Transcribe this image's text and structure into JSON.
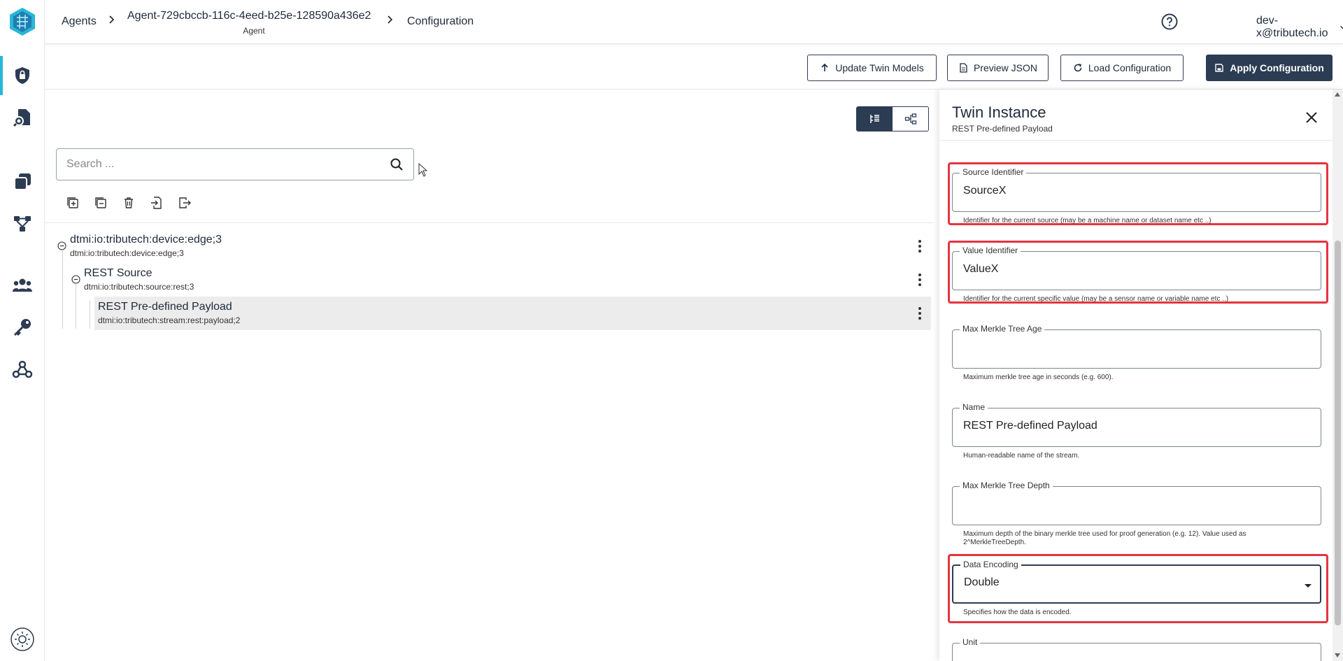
{
  "nav": {
    "items": [
      "lock-shield-icon",
      "document-search-icon",
      "stacked-cards-icon",
      "workflow-icon",
      "users-icon",
      "key-icon",
      "webhook-icon"
    ],
    "active": 0
  },
  "breadcrumb": {
    "agents": "Agents",
    "agent_id": "Agent-729cbccb-116c-4eed-b25e-128590a436e2",
    "agent_sub": "Agent",
    "config": "Configuration"
  },
  "user": {
    "email": "dev-x@tributech.io"
  },
  "toolbar": {
    "update": "Update Twin Models",
    "preview": "Preview JSON",
    "load": "Load Configuration",
    "apply": "Apply Configuration"
  },
  "search": {
    "placeholder": "Search ..."
  },
  "tree": {
    "root": {
      "name": "dtmi:io:tributech:device:edge;3",
      "id": "dtmi:io:tributech:device:edge;3"
    },
    "source": {
      "name": "REST Source",
      "id": "dtmi:io:tributech:source:rest;3"
    },
    "stream": {
      "name": "REST Pre-defined Payload",
      "id": "dtmi:io:tributech:stream:rest:payload;2"
    }
  },
  "panel": {
    "title": "Twin Instance",
    "subtitle": "REST Pre-defined Payload",
    "fields": [
      {
        "label": "Source Identifier",
        "value": "SourceX",
        "hint": "Identifier for the current source (may be a machine name or dataset name etc ..)"
      },
      {
        "label": "Value Identifier",
        "value": "ValueX",
        "hint": "Identifier for the current specific value (may be a sensor name or variable name etc ..)"
      },
      {
        "label": "Max Merkle Tree Age",
        "value": "",
        "hint": "Maximum merkle tree age in seconds (e.g. 600)."
      },
      {
        "label": "Name",
        "value": "REST Pre-defined Payload",
        "hint": "Human-readable name of the stream."
      },
      {
        "label": "Max Merkle Tree Depth",
        "value": "",
        "hint": "Maximum depth of the binary merkle tree used for proof generation (e.g. 12). Value used as 2^MerkleTreeDepth."
      },
      {
        "label": "Data Encoding",
        "value": "Double",
        "hint": "Specifies how the data is encoded."
      },
      {
        "label": "Unit",
        "value": ""
      }
    ]
  },
  "colors": {
    "primary": "#2b3c53",
    "accent": "#29b6d8",
    "highlight": "#e5343f"
  }
}
